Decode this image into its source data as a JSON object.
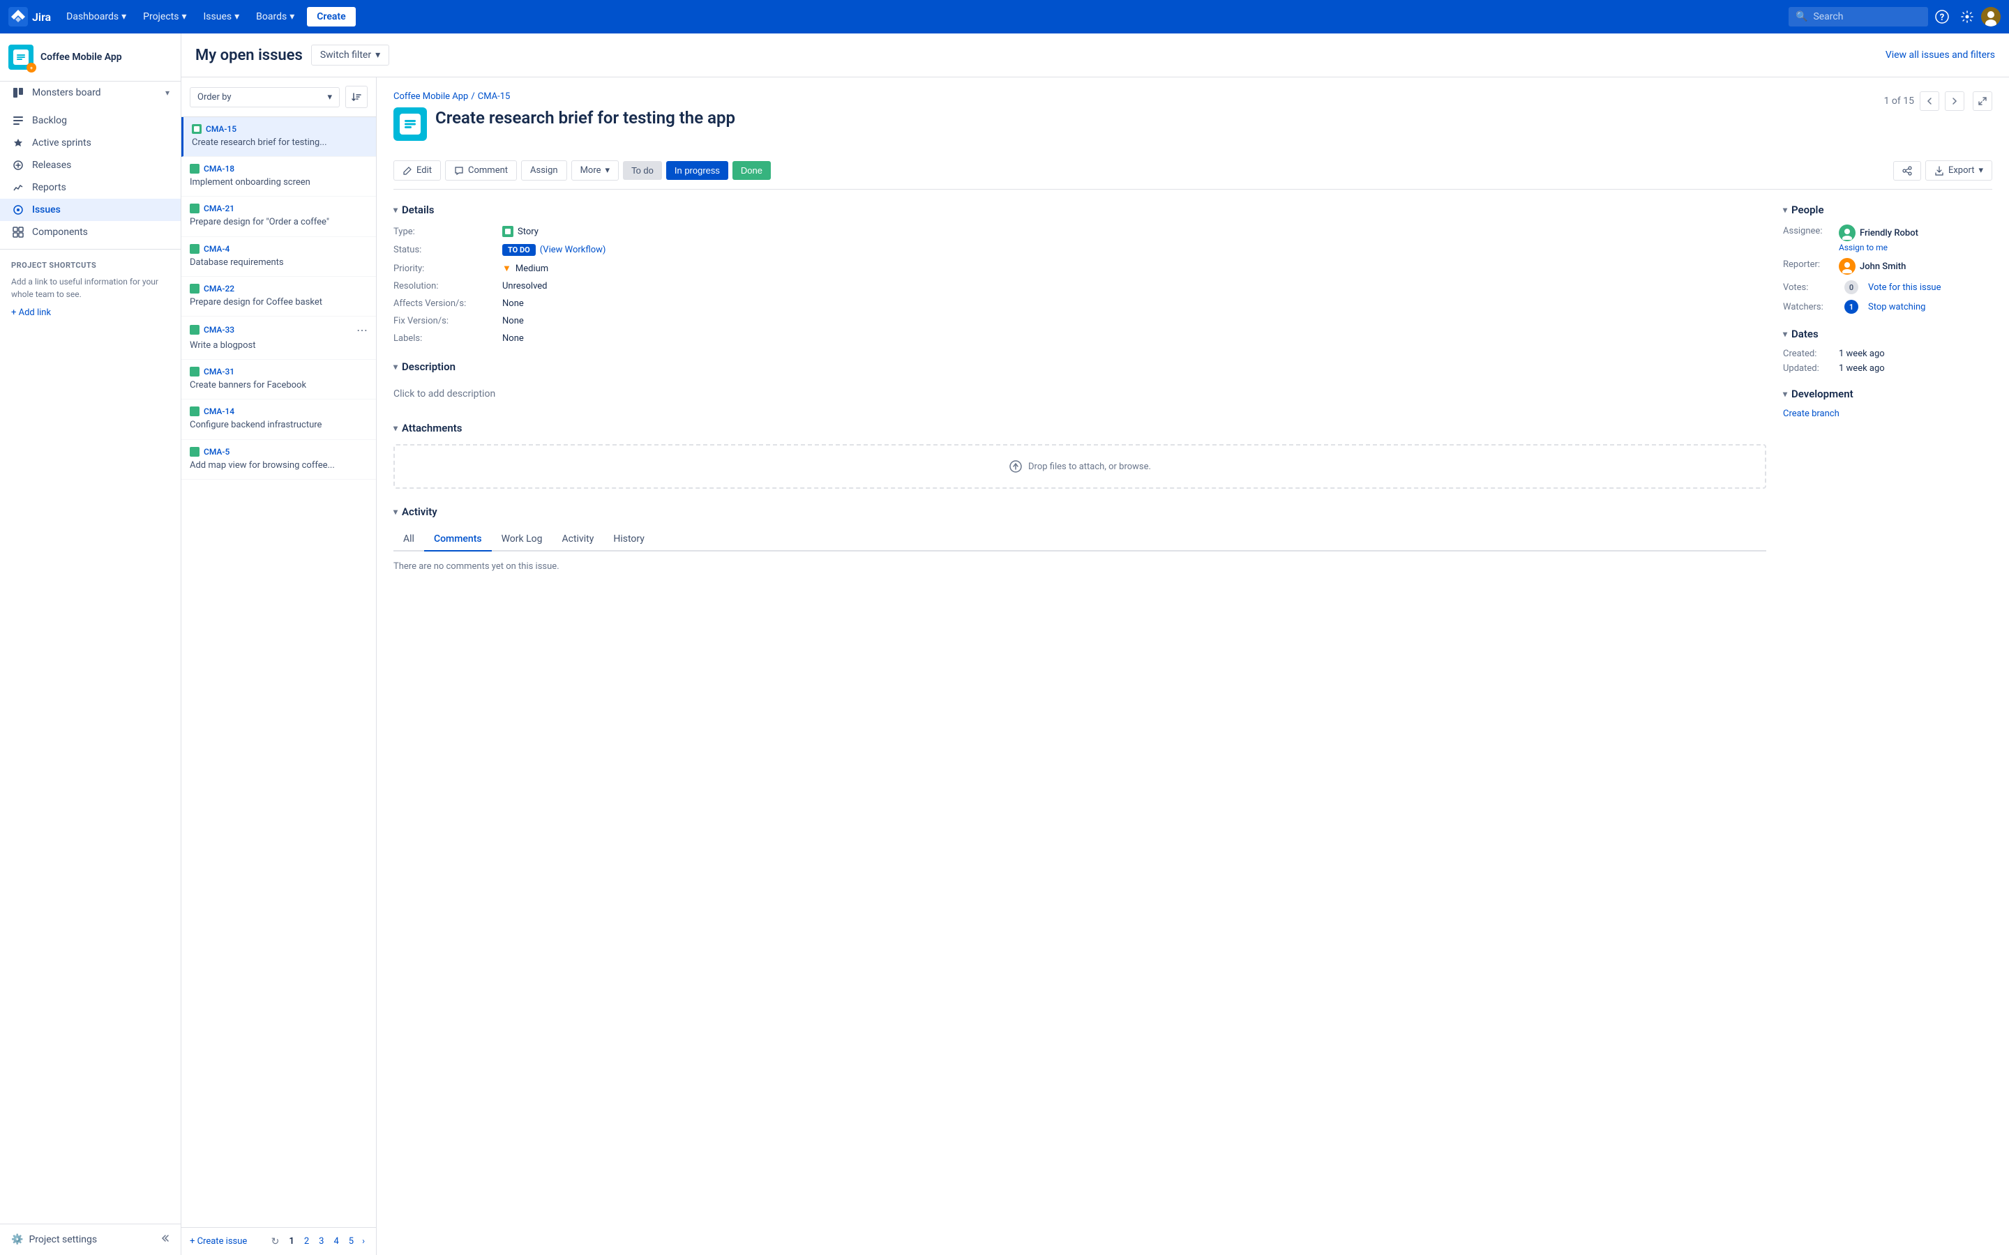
{
  "topNav": {
    "logo_text": "Jira",
    "dashboards": "Dashboards",
    "projects": "Projects",
    "issues": "Issues",
    "boards": "Boards",
    "create": "Create",
    "search_placeholder": "Search",
    "active_page": "Boards"
  },
  "sidebar": {
    "project_name": "Coffee Mobile App",
    "board_item": "Monsters board",
    "nav_items": [
      {
        "id": "backlog",
        "label": "Backlog",
        "icon": "list"
      },
      {
        "id": "active-sprints",
        "label": "Active sprints",
        "icon": "lightning"
      },
      {
        "id": "releases",
        "label": "Releases",
        "icon": "tag"
      },
      {
        "id": "reports",
        "label": "Reports",
        "icon": "chart"
      },
      {
        "id": "issues",
        "label": "Issues",
        "icon": "issue",
        "active": true
      },
      {
        "id": "components",
        "label": "Components",
        "icon": "puzzle"
      }
    ],
    "shortcuts_title": "PROJECT SHORTCUTS",
    "shortcuts_desc": "Add a link to useful information for your whole team to see.",
    "add_link": "+ Add link",
    "settings_label": "Project settings"
  },
  "pageHeader": {
    "title": "My open issues",
    "switch_filter": "Switch filter",
    "view_all": "View all issues and filters"
  },
  "issuesList": {
    "order_by": "Order by",
    "issues": [
      {
        "id": "CMA-15",
        "title": "Create research brief for testing...",
        "selected": true
      },
      {
        "id": "CMA-18",
        "title": "Implement onboarding screen",
        "selected": false
      },
      {
        "id": "CMA-21",
        "title": "Prepare design for \"Order a coffee\"",
        "selected": false
      },
      {
        "id": "CMA-4",
        "title": "Database requirements",
        "selected": false
      },
      {
        "id": "CMA-22",
        "title": "Prepare design for Coffee basket",
        "selected": false
      },
      {
        "id": "CMA-33",
        "title": "Write a blogpost",
        "selected": false,
        "has_more": true
      },
      {
        "id": "CMA-31",
        "title": "Create banners for Facebook",
        "selected": false
      },
      {
        "id": "CMA-14",
        "title": "Configure backend infrastructure",
        "selected": false
      },
      {
        "id": "CMA-5",
        "title": "Add map view for browsing coffee...",
        "selected": false
      }
    ],
    "create_issue": "+ Create issue",
    "pages": [
      "1",
      "2",
      "3",
      "4",
      "5"
    ]
  },
  "issueDetail": {
    "breadcrumb_project": "Coffee Mobile App",
    "breadcrumb_id": "CMA-15",
    "title": "Create research brief for testing the app",
    "counter": "1 of 15",
    "actions": {
      "edit": "Edit",
      "comment": "Comment",
      "assign": "Assign",
      "more": "More",
      "todo": "To do",
      "in_progress": "In progress",
      "done": "Done",
      "share": "Share",
      "export": "Export"
    },
    "details": {
      "type_label": "Type:",
      "type_value": "Story",
      "status_label": "Status:",
      "status_badge": "TO DO",
      "status_workflow": "(View Workflow)",
      "priority_label": "Priority:",
      "priority_value": "Medium",
      "resolution_label": "Resolution:",
      "resolution_value": "Unresolved",
      "affects_label": "Affects Version/s:",
      "affects_value": "None",
      "fix_label": "Fix Version/s:",
      "fix_value": "None",
      "labels_label": "Labels:",
      "labels_value": "None"
    },
    "people": {
      "assignee_label": "Assignee:",
      "assignee_name": "Friendly Robot",
      "assign_to_me": "Assign to me",
      "reporter_label": "Reporter:",
      "reporter_name": "John Smith",
      "votes_label": "Votes:",
      "votes_count": "0",
      "vote_link": "Vote for this issue",
      "watchers_label": "Watchers:",
      "watchers_count": "1",
      "watch_link": "Stop watching"
    },
    "description": {
      "section": "Description",
      "placeholder": "Click to add description"
    },
    "attachments": {
      "section": "Attachments",
      "drop_text": "Drop files to attach, or browse."
    },
    "activity": {
      "section": "Activity",
      "tabs": [
        "All",
        "Comments",
        "Work Log",
        "Activity",
        "History"
      ],
      "active_tab": "Comments",
      "empty_text": "There are no comments yet on this issue."
    },
    "dates": {
      "section": "Dates",
      "created_label": "Created:",
      "created_value": "1 week ago",
      "updated_label": "Updated:",
      "updated_value": "1 week ago"
    },
    "development": {
      "section": "Development",
      "create_branch": "Create branch"
    }
  }
}
